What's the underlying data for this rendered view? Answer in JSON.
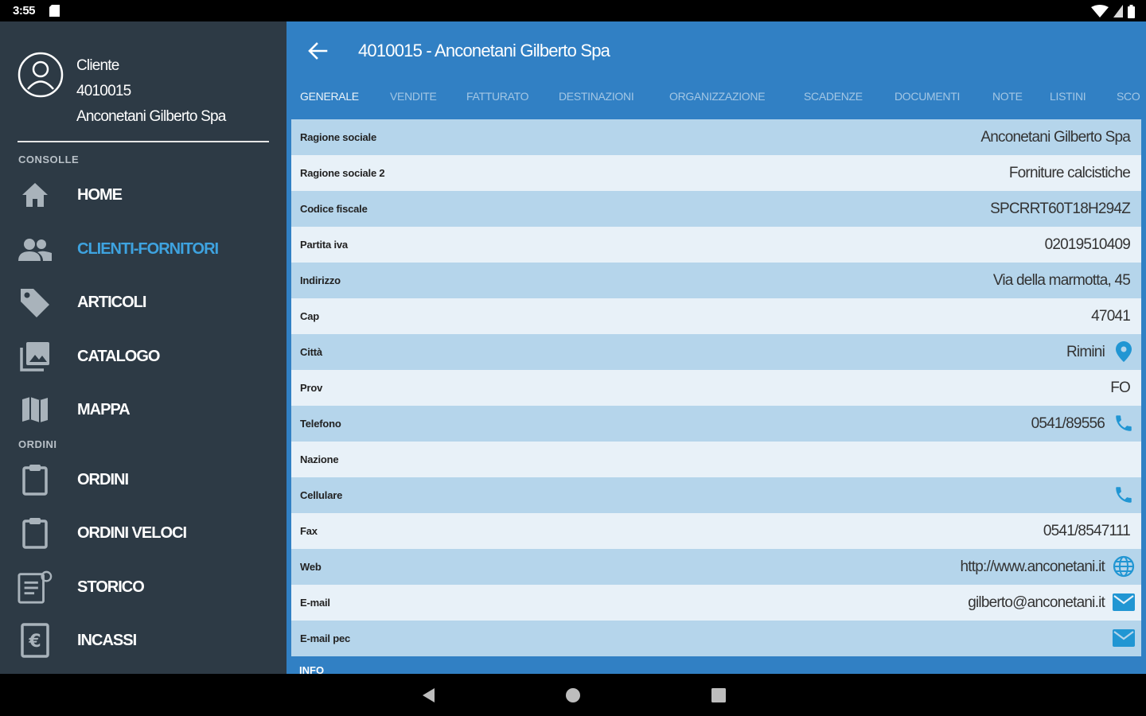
{
  "status": {
    "time": "3:55"
  },
  "drawer": {
    "header": {
      "line1": "Cliente",
      "line2": "4010015",
      "line3": "Anconetani Gilberto Spa"
    },
    "section_console": "CONSOLLE",
    "section_orders": "ORDINI",
    "items": [
      {
        "label": "HOME",
        "icon": "home-icon"
      },
      {
        "label": "CLIENTI-FORNITORI",
        "icon": "people-icon"
      },
      {
        "label": "ARTICOLI",
        "icon": "tag-icon"
      },
      {
        "label": "CATALOGO",
        "icon": "photo-library-icon"
      },
      {
        "label": "MAPPA",
        "icon": "map-icon"
      },
      {
        "label": "ORDINI",
        "icon": "clipboard-icon"
      },
      {
        "label": "ORDINI VELOCI",
        "icon": "clipboard-icon"
      },
      {
        "label": "STORICO",
        "icon": "history-icon"
      },
      {
        "label": "INCASSI",
        "icon": "euro-icon"
      }
    ],
    "active_item": "CLIENTI-FORNITORI"
  },
  "toolbar": {
    "title": "4010015 - Anconetani Gilberto Spa"
  },
  "tabs": [
    "GENERALE",
    "VENDITE",
    "FATTURATO",
    "DESTINAZIONI",
    "ORGANIZZAZIONE",
    "SCADENZE",
    "DOCUMENTI",
    "NOTE",
    "LISTINI",
    "SCO"
  ],
  "active_tab": "GENERALE",
  "fields": [
    {
      "label": "Ragione sociale",
      "value": "Anconetani Gilberto Spa",
      "icon": ""
    },
    {
      "label": "Ragione sociale 2",
      "value": "Forniture calcistiche",
      "icon": ""
    },
    {
      "label": "Codice fiscale",
      "value": "SPCRRT60T18H294Z",
      "icon": ""
    },
    {
      "label": "Partita iva",
      "value": "02019510409",
      "icon": ""
    },
    {
      "label": "Indirizzo",
      "value": "Via della marmotta, 45",
      "icon": ""
    },
    {
      "label": "Cap",
      "value": "47041",
      "icon": ""
    },
    {
      "label": "Città",
      "value": "Rimini",
      "icon": "location-pin-icon"
    },
    {
      "label": "Prov",
      "value": "FO",
      "icon": ""
    },
    {
      "label": "Telefono",
      "value": "0541/89556",
      "icon": "phone-icon"
    },
    {
      "label": "Nazione",
      "value": "",
      "icon": ""
    },
    {
      "label": "Cellulare",
      "value": "",
      "icon": "phone-icon"
    },
    {
      "label": "Fax",
      "value": "0541/8547111",
      "icon": ""
    },
    {
      "label": "Web",
      "value": "http://www.anconetani.it",
      "icon": "globe-icon"
    },
    {
      "label": "E-mail",
      "value": "gilberto@anconetani.it",
      "icon": "mail-icon"
    },
    {
      "label": "E-mail pec",
      "value": "",
      "icon": "mail-icon"
    }
  ],
  "info_caption": "INFO",
  "colors": {
    "drawer_bg": "#2d3a45",
    "primary": "#3180c4",
    "accent": "#3ea3e0",
    "row_odd": "#b5d5eb",
    "row_even": "#e8f1f8"
  }
}
